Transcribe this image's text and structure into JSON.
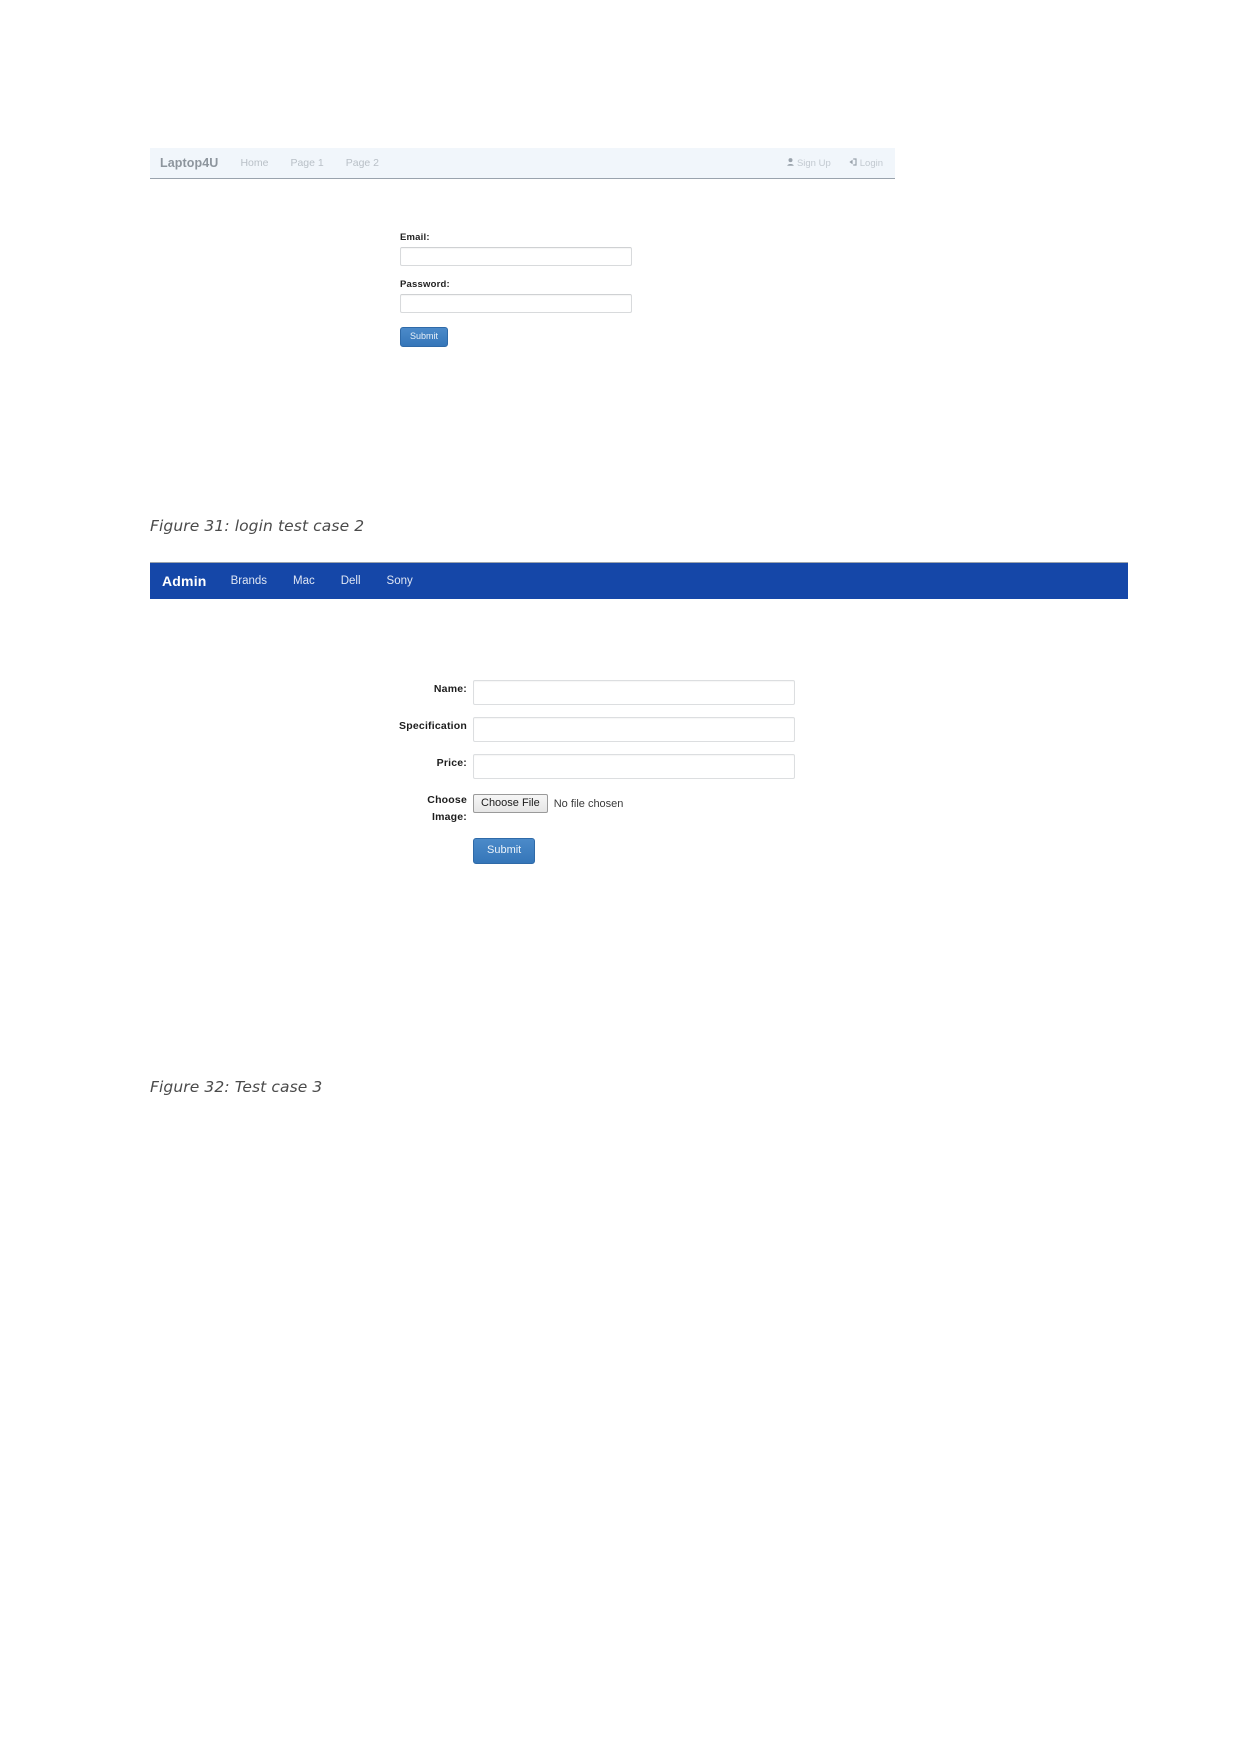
{
  "document": {
    "captions": {
      "figure_31": "Figure 31: login test case 2",
      "figure_32": "Figure 32: Test case 3"
    }
  },
  "screenshot_login": {
    "navbar": {
      "brand": "Laptop4U",
      "links": [
        "Home",
        "Page 1",
        "Page 2"
      ],
      "right_links": [
        {
          "label": "Sign Up",
          "icon": "user-icon",
          "glyph": "\u0001F464"
        },
        {
          "label": "Login",
          "icon": "sign-in-icon",
          "glyph": "→]"
        }
      ],
      "background_color": "#f1f6fb",
      "text_color": "#b9c0c7"
    },
    "form": {
      "email_label": "Email:",
      "email_value": "",
      "email_placeholder": "",
      "password_label": "Password:",
      "password_value": "",
      "password_placeholder": "",
      "submit_label": "Submit",
      "submit_color": "#3c7fc1"
    }
  },
  "screenshot_admin": {
    "navbar": {
      "brand": "Admin",
      "links": [
        "Brands",
        "Mac",
        "Dell",
        "Sony"
      ],
      "background_color": "#1547a8",
      "text_color": "#dfe6f4"
    },
    "form": {
      "name_label": "Name:",
      "name_value": "",
      "name_placeholder": "",
      "specification_label": "Specification",
      "specification_value": "",
      "specification_placeholder": "",
      "price_label": "Price:",
      "price_value": "",
      "price_placeholder": "",
      "image_label_line1": "Choose",
      "image_label_line2": "Image:",
      "choose_file_label": "Choose File",
      "file_status": "No file chosen",
      "submit_label": "Submit",
      "submit_color": "#3c7fc1"
    }
  }
}
